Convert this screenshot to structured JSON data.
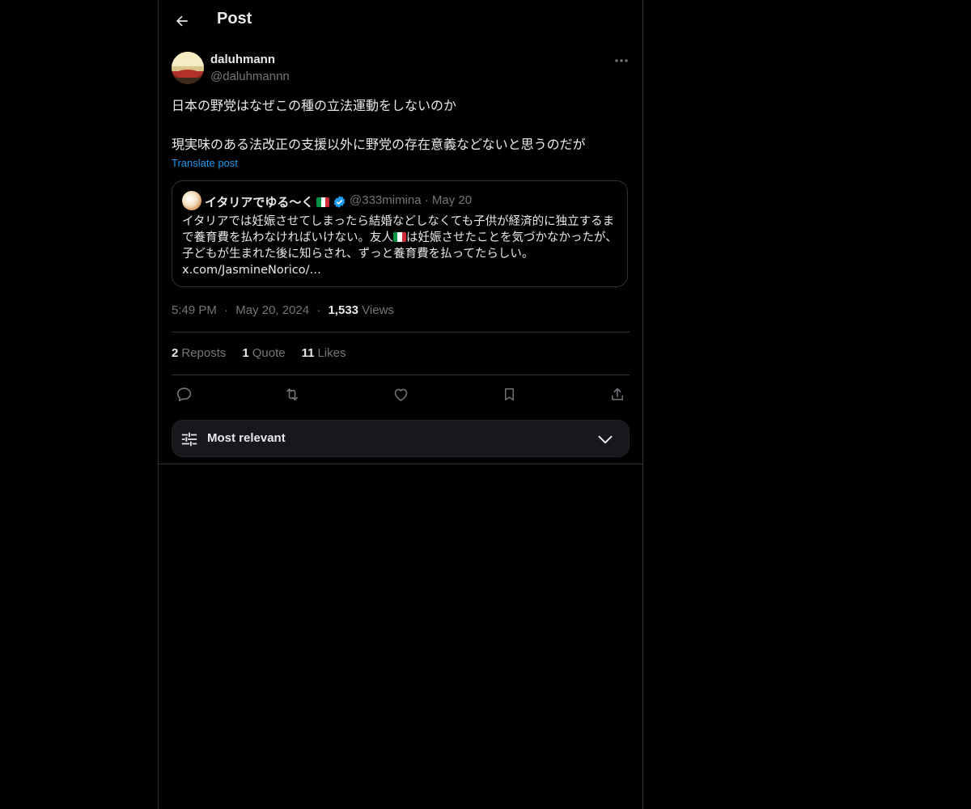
{
  "header": {
    "title": "Post"
  },
  "post": {
    "author_name": "daluhmann",
    "author_handle": "@daluhmannn",
    "text": "日本の野党はなぜこの種の立法運動をしないのか\n\n現実味のある法改正の支援以外に野党の存在意義などないと思うのだが",
    "translate_label": "Translate post"
  },
  "quote": {
    "name": "イタリアでゆる〜く",
    "handle_and_date": "@333mimina · May 20",
    "text_part1": "イタリアでは妊娠させてしまったら結婚などしなくても子供が経済的に独立するまで養育費を払わなければいけない。友人",
    "text_part2": "は妊娠させたことを気づかなかったが、子どもが生まれた後に知らされ、ずっと養育費を払ってたらしい。",
    "link": "x.com/JasmineNorico/…",
    "flag_colors": [
      "#009246",
      "#ffffff",
      "#ce2b37"
    ],
    "verified_color": "#1d9bf0"
  },
  "meta": {
    "time": "5:49 PM",
    "date": "May 20, 2024",
    "views_count": "1,533",
    "views_label": "Views",
    "sep": "·"
  },
  "stats": {
    "reposts_count": "2",
    "reposts_label": "Reposts",
    "quotes_count": "1",
    "quotes_label": "Quote",
    "likes_count": "11",
    "likes_label": "Likes"
  },
  "actions": [
    "reply-icon",
    "repost-icon",
    "like-icon",
    "bookmark-icon",
    "share-icon"
  ],
  "sort": {
    "label": "Most relevant"
  },
  "colors": {
    "background": "#000000",
    "text": "#e7e9ea",
    "muted": "#71767b",
    "link": "#1d9bf0",
    "border": "#2f3336"
  }
}
